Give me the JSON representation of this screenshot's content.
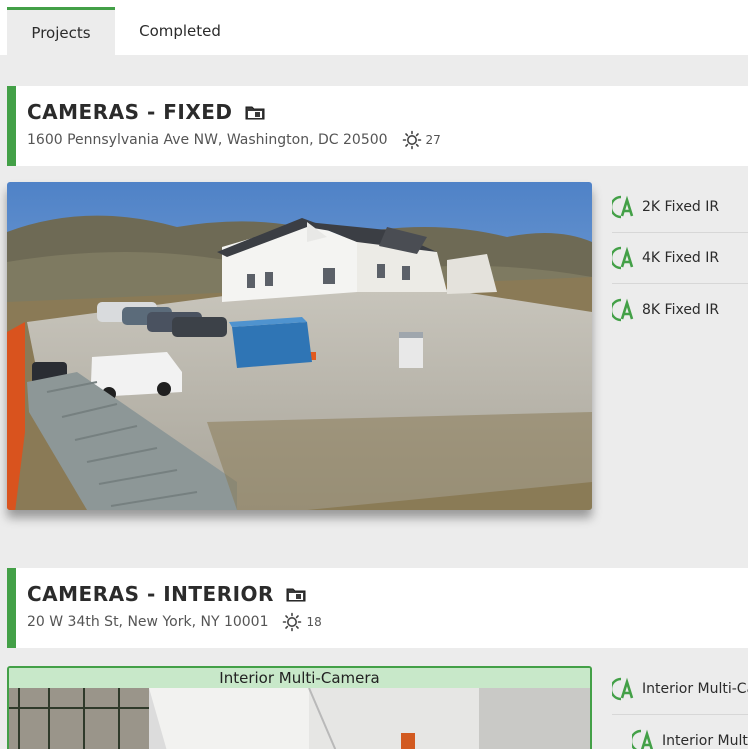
{
  "tabs": [
    {
      "label": "Projects",
      "active": true
    },
    {
      "label": "Completed",
      "active": false
    }
  ],
  "projects": [
    {
      "title": "CAMERAS - FIXED",
      "address": "1600 Pennsylvania Ave NW, Washington, DC 20500",
      "weather_icon": "sun-icon",
      "temperature": "27",
      "cameras": [
        "2K Fixed IR",
        "4K Fixed IR",
        "8K Fixed IR"
      ]
    },
    {
      "title": "CAMERAS - INTERIOR",
      "address": "20 W 34th St, New York, NY 10001",
      "weather_icon": "sun-icon",
      "temperature": "18",
      "preview_label": "Interior Multi-Camera",
      "cameras": [
        "Interior Multi-Camera",
        "Interior Multi-Camera"
      ]
    }
  ],
  "colors": {
    "accent": "#43a047",
    "label_bg": "#c8e8c9"
  }
}
